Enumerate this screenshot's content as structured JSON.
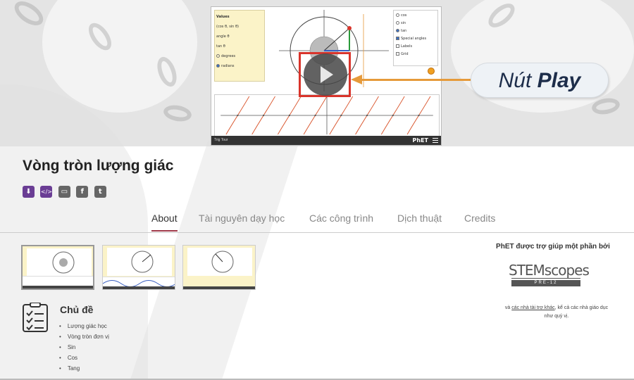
{
  "video": {
    "panel_left": {
      "title": "Values",
      "rows": [
        "(cos θ, sin θ)",
        "angle θ",
        "tan θ"
      ],
      "units": [
        {
          "label": "degrees",
          "selected": false
        },
        {
          "label": "radians",
          "selected": true
        }
      ]
    },
    "panel_right": {
      "functions": [
        {
          "label": "cos",
          "selected": false
        },
        {
          "label": "sin",
          "selected": false
        },
        {
          "label": "tan",
          "selected": true
        }
      ],
      "options": [
        {
          "label": "Special angles",
          "checked": true
        },
        {
          "label": "Labels",
          "checked": false
        },
        {
          "label": "Grid",
          "checked": false
        }
      ]
    },
    "bottom_label": "Trig Tour",
    "logo": "PhET"
  },
  "callout": {
    "prefix": "Nút ",
    "emphasis": "Play"
  },
  "page": {
    "title": "Vòng tròn lượng giác"
  },
  "share_icons": [
    {
      "name": "download-icon",
      "glyph": "⬇",
      "color": "#6a3d94"
    },
    {
      "name": "embed-icon",
      "glyph": "</>",
      "color": "#6a3d94"
    },
    {
      "name": "classroom-icon",
      "glyph": "▭",
      "color": "#666666"
    },
    {
      "name": "facebook-icon",
      "glyph": "f",
      "color": "#666666"
    },
    {
      "name": "twitter-icon",
      "glyph": "t",
      "color": "#666666"
    }
  ],
  "tabs": [
    {
      "label": "About",
      "active": true
    },
    {
      "label": "Tài nguyên dạy học",
      "active": false
    },
    {
      "label": "Các công trình",
      "active": false
    },
    {
      "label": "Dịch thuật",
      "active": false
    },
    {
      "label": "Credits",
      "active": false
    }
  ],
  "topics": {
    "title": "Chủ đề",
    "items": [
      "Lượng giác học",
      "Vòng tròn đơn vị",
      "Sin",
      "Cos",
      "Tang"
    ]
  },
  "sponsor": {
    "heading": "PhET được trợ giúp một phần bởi",
    "logo_main": "STEMscopes",
    "logo_sub": "PRE-12",
    "note_prefix": "và ",
    "note_link": "các nhà tài trợ khác",
    "note_suffix": ", kể cả các nhà giáo dục như quý vị."
  },
  "colors": {
    "accent": "#a03a4a",
    "highlight_box": "#d9342b",
    "arrow": "#e69a3a",
    "sim_panel": "#fbf3c8"
  }
}
